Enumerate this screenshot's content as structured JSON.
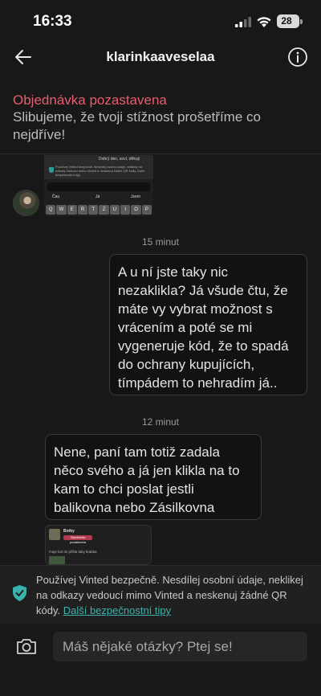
{
  "status": {
    "time": "16:33",
    "battery": "28"
  },
  "header": {
    "title": "klarinkaaveselaa",
    "back_icon": "arrow-left-icon",
    "info_icon": "info-icon"
  },
  "banner": {
    "title": "Objednávka pozastavena",
    "text": "Slibujeme, že tvoji stížnost prošetříme co nejdříve!",
    "title_color": "#e85d6d"
  },
  "chat": {
    "shot1": {
      "top_text": "Dobrý den, soví, děkuji",
      "info_text": "Používej Vinted bezpečně. Nesdílej osobní údaje, neklikej na odkazy vedoucí mimo Vinted a neskenuj žádné QR kódy. Další bezpečnostní tipy",
      "suggestions": [
        "Čau",
        "Já",
        "Jsem"
      ],
      "keys": [
        "Q",
        "W",
        "E",
        "R",
        "T",
        "Z",
        "U",
        "I",
        "O",
        "P"
      ]
    },
    "timestamp1": "15 minut",
    "message_out": "A u ní jste taky nic nezaklikla? Já všude čtu, že máte vy vybrat možnost s vrácením a poté se mi vygeneruje kód, že to spadá do ochrany kupujících, tímpádem to nehradím já..",
    "timestamp2": "12 minut",
    "message_in": "Nene, paní tam totiž zadala něco svého a já jen klikla na to kam to chci poslat jestli balikovna nebo Zásilkovna",
    "shot2": {
      "name": "Botky",
      "badge": "Objednávka pozastavena",
      "message": "moje bot mi přišla taky krabka"
    }
  },
  "safety": {
    "text": "Používej Vinted bezpečně. Nesdílej osobní údaje, neklikej na odkazy vedoucí mimo Vinted a neskenuj žádné QR kódy.",
    "link": "Další bezpečnostní tipy",
    "accent": "#3bb3ad"
  },
  "composer": {
    "placeholder": "Máš nějaké otázky? Ptej se!",
    "camera_icon": "camera-icon"
  }
}
